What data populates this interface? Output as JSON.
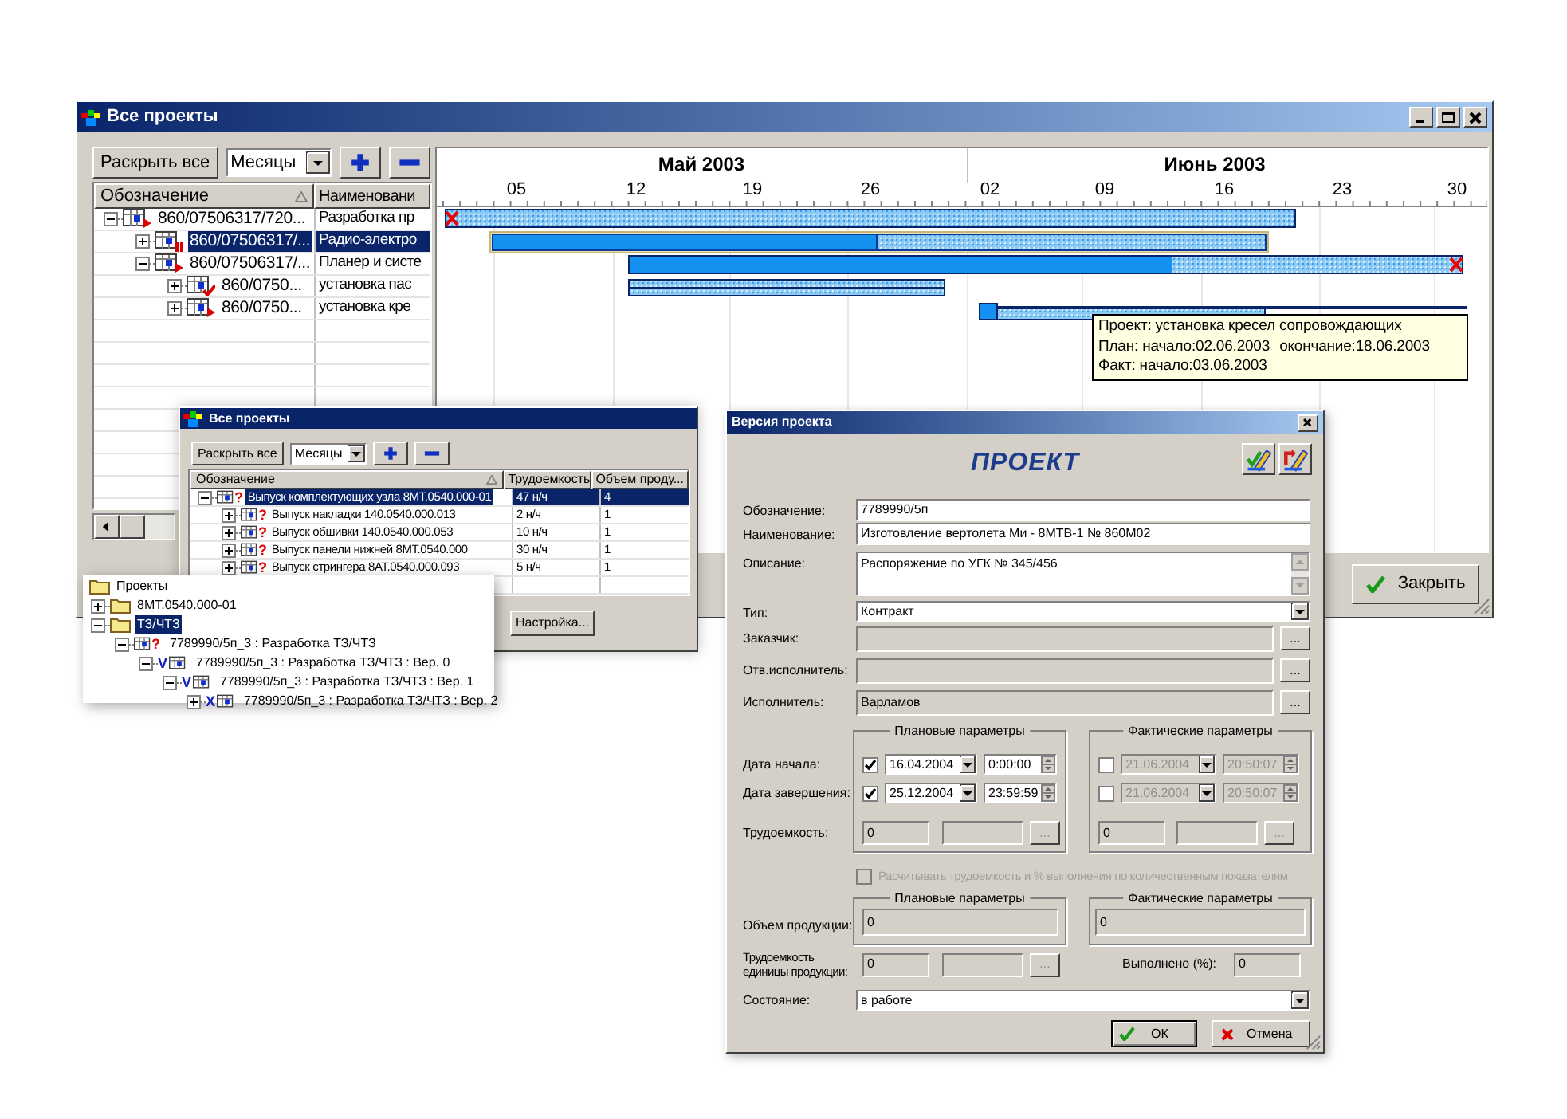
{
  "main_window": {
    "title": "Все проекты",
    "toolbar": {
      "expand_all": "Раскрыть все",
      "scale": "Месяцы"
    },
    "columns": [
      "Обозначение",
      "Наименовани"
    ],
    "rows": [
      {
        "code": "860/07506317/720...",
        "name": "Разработка пр",
        "kind": "flag",
        "expanded": true,
        "selected": false,
        "children": [
          {
            "code": "860/07506317/...",
            "name": "Радио-электро",
            "kind": "pause",
            "expanded": false,
            "selected": true
          },
          {
            "code": "860/07506317/...",
            "name": "Планер и систе",
            "kind": "flag",
            "expanded": true,
            "selected": false,
            "children": [
              {
                "code": "860/0750...",
                "name": "установка пас",
                "kind": "check",
                "expanded": false,
                "selected": false
              },
              {
                "code": "860/0750...",
                "name": "установка кре",
                "kind": "flag",
                "expanded": false,
                "selected": false
              }
            ]
          }
        ]
      }
    ],
    "gantt": {
      "months": [
        "Май 2003",
        "Июнь 2003"
      ],
      "days": [
        "05",
        "12",
        "19",
        "26",
        "02",
        "09",
        "16",
        "23",
        "30"
      ],
      "tooltip": {
        "project": "Проект: установка кресел сопровождающих",
        "plan_start": "План: начало:02.06.2003",
        "plan_end": "окончание:18.06.2003",
        "fact": "Факт: начало:03.06.2003"
      }
    },
    "close_button": "Закрыть"
  },
  "projects_window": {
    "title": "Все проекты",
    "toolbar": {
      "expand_all": "Раскрыть все",
      "scale": "Месяцы"
    },
    "columns": [
      "Обозначение",
      "Трудоемкость",
      "Объем проду..."
    ],
    "rows": [
      {
        "name": "Выпуск комплектующих узла 8МТ.0540.000-01",
        "labor": "47 н/ч",
        "volume": "4",
        "mark": "?",
        "expanded": true,
        "selected": true,
        "children": [
          {
            "name": "Выпуск накладки 140.0540.000.013",
            "labor": "2 н/ч",
            "volume": "1",
            "mark": "?",
            "expanded": false,
            "selected": false
          },
          {
            "name": "Выпуск обшивки 140.0540.000.053",
            "labor": "10 н/ч",
            "volume": "1",
            "mark": "?",
            "expanded": false,
            "selected": false
          },
          {
            "name": "Выпуск панели нижней 8МТ.0540.000",
            "labor": "30 н/ч",
            "volume": "1",
            "mark": "?",
            "expanded": false,
            "selected": false
          },
          {
            "name": "Выпуск стрингера 8АТ.0540.000.093",
            "labor": "5 н/ч",
            "volume": "1",
            "mark": "?",
            "expanded": false,
            "selected": false
          }
        ]
      }
    ],
    "settings_button": "Настройка..."
  },
  "tree_popup": {
    "items": [
      {
        "kind": "root",
        "label": "Проекты",
        "selected": false
      },
      {
        "kind": "folder",
        "label": "8МТ.0540.000-01",
        "expanded": false,
        "selected": false
      },
      {
        "kind": "folder",
        "label": "ТЗ/ЧТЗ",
        "expanded": true,
        "selected": true,
        "children": [
          {
            "kind": "task",
            "mark": "?",
            "label": "7789990/5п_3 : Разработка ТЗ/ЧТЗ",
            "expanded": true,
            "selected": false,
            "children": [
              {
                "kind": "version",
                "mark": "V",
                "label": "7789990/5п_3 : Разработка ТЗ/ЧТЗ : Вер. 0",
                "expanded": true,
                "selected": false,
                "children": [
                  {
                    "kind": "version",
                    "mark": "V",
                    "label": "7789990/5п_3 : Разработка ТЗ/ЧТЗ : Вер. 1",
                    "expanded": true,
                    "selected": false,
                    "children": [
                      {
                        "kind": "version",
                        "mark": "X",
                        "label": "7789990/5п_3 : Разработка ТЗ/ЧТЗ : Вер. 2",
                        "expanded": false,
                        "selected": false
                      }
                    ]
                  }
                ]
              }
            ]
          }
        ]
      }
    ]
  },
  "version_dialog": {
    "title": "Версия проекта",
    "heading": "ПРОЕКТ",
    "fields": [
      {
        "kind": "text",
        "label": "Обозначение:",
        "value": "7789990/5п"
      },
      {
        "kind": "text",
        "label": "Наименование:",
        "value": "Изготовление вертолета Ми - 8МТВ-1 № 860М02"
      },
      {
        "kind": "memo",
        "label": "Описание:",
        "value": "Распоряжение по УГК № 345/456"
      },
      {
        "kind": "combo",
        "label": "Тип:",
        "value": "Контракт"
      },
      {
        "kind": "lookup",
        "label": "Заказчик:",
        "button": "..."
      },
      {
        "kind": "lookup",
        "label": "Отв.исполнитель:",
        "button": "..."
      },
      {
        "kind": "lookup",
        "label": "Исполнитель:",
        "value": "Варламов",
        "button": "..."
      }
    ],
    "plan_title": "Плановые параметры",
    "fact_title": "Фактические параметры",
    "dates": [
      {
        "label": "Дата начала:",
        "plan": {
          "checked": true,
          "date": "16.04.2004",
          "time": "0:00:00"
        },
        "fact": {
          "checked": false,
          "date": "21.06.2004",
          "time": "20:50:07"
        }
      },
      {
        "label": "Дата завершения:",
        "plan": {
          "checked": true,
          "date": "25.12.2004",
          "time": "23:59:59"
        },
        "fact": {
          "checked": false,
          "date": "21.06.2004",
          "time": "20:50:07"
        }
      }
    ],
    "labor": {
      "label": "Трудоемкость:",
      "plan": {
        "value": "0",
        "button": "..."
      },
      "fact": {
        "value": "0",
        "button": "..."
      }
    },
    "calc_option": {
      "label": "Расчитывать трудоемкость и % выполнения по количественным показателям",
      "checked": false,
      "disabled": true
    },
    "volume": {
      "label": "Объем продукции:",
      "plan_title": "Плановые параметры",
      "fact_title": "Фактические параметры",
      "plan": "0",
      "fact": "0"
    },
    "unit_labor": {
      "label": "Трудоемкость единицы продукции:",
      "value": "0",
      "button": "..."
    },
    "done": {
      "label": "Выполнено (%):",
      "value": "0"
    },
    "state": {
      "label": "Состояние:",
      "value": "в работе"
    },
    "ok_button": "ОК",
    "cancel_button": "Отмена"
  }
}
